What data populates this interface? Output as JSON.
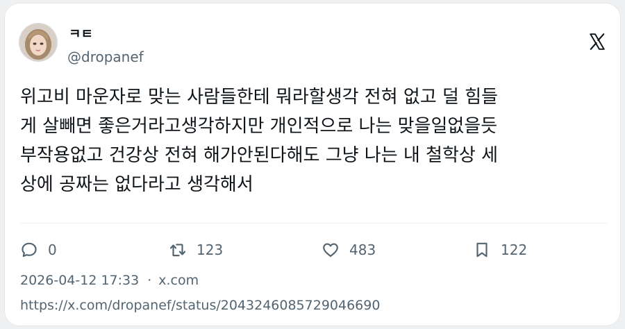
{
  "post": {
    "display_name": "ㅋㅌ",
    "handle": "@dropanef",
    "text_lines": [
      "위고비 마운자로 맞는 사람들한테 뭐라할생각 전혀 없고 덜 힘들",
      "게 살빼면 좋은거라고생각하지만 개인적으로 나는 맞을일없을듯",
      "부작용없고 건강상 전혀 해가안된다해도 그냥 나는 내 철학상 세",
      "상에 공짜는 없다라고 생각해서"
    ],
    "timestamp": "2026-04-12 17:33",
    "separator": "·",
    "source": "x.com",
    "url": "https://x.com/dropanef/status/2043246085729046690"
  },
  "actions": {
    "reply_count": "0",
    "repost_count": "123",
    "like_count": "483",
    "bookmark_count": "122"
  },
  "icons": {
    "avatar": "avatar-image",
    "brand": "x-logo-icon",
    "reply": "reply-bubble-icon",
    "repost": "repost-arrows-icon",
    "like": "heart-icon",
    "bookmark": "bookmark-icon"
  },
  "colors": {
    "text": "#0f1419",
    "secondary": "#536471",
    "border": "#e4e6e8"
  }
}
